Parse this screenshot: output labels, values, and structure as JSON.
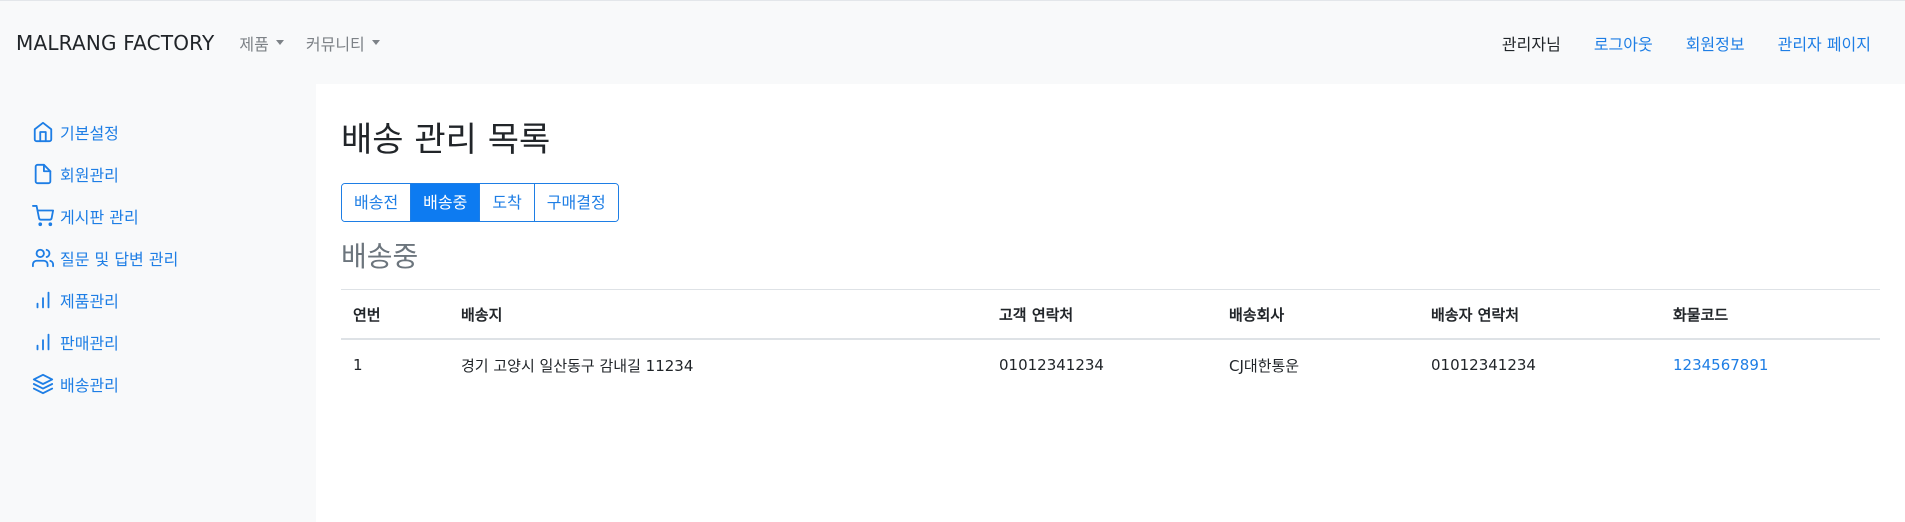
{
  "navbar": {
    "brand": "MALRANG FACTORY",
    "menus": [
      {
        "label": "제품"
      },
      {
        "label": "커뮤니티"
      }
    ],
    "user_label": "관리자님",
    "links": {
      "logout": "로그아웃",
      "member_info": "회원정보",
      "admin_page": "관리자 페이지"
    }
  },
  "sidebar": {
    "items": [
      {
        "label": "기본설정",
        "icon": "home-icon"
      },
      {
        "label": "회원관리",
        "icon": "file-icon"
      },
      {
        "label": "게시판 관리",
        "icon": "shopping-cart-icon"
      },
      {
        "label": "질문 및 답변 관리",
        "icon": "users-icon"
      },
      {
        "label": "제품관리",
        "icon": "bar-chart-icon"
      },
      {
        "label": "판매관리",
        "icon": "bar-chart-icon"
      },
      {
        "label": "배송관리",
        "icon": "layers-icon"
      }
    ]
  },
  "main": {
    "title": "배송 관리 목록",
    "tabs": [
      {
        "label": "배송전",
        "active": false
      },
      {
        "label": "배송중",
        "active": true
      },
      {
        "label": "도착",
        "active": false
      },
      {
        "label": "구매결정",
        "active": false
      }
    ],
    "section_title": "배송중",
    "table": {
      "headers": [
        "연번",
        "배송지",
        "고객 연락처",
        "배송회사",
        "배송자 연락처",
        "화물코드"
      ],
      "rows": [
        [
          "1",
          "경기 고양시 일산동구 감내길 11234",
          "01012341234",
          "CJ대한통운",
          "01012341234",
          "1234567891"
        ]
      ]
    }
  },
  "colors": {
    "accent": "#1e7ee5",
    "active_tab": "#0d7bf1",
    "sidebar_bg": "#f8f9fa",
    "muted": "#6c757d"
  }
}
